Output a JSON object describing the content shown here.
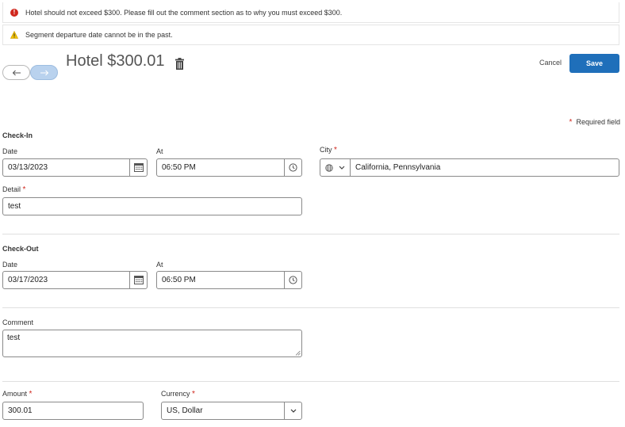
{
  "alerts": {
    "error": "Hotel should not exceed $300. Please fill out the comment section as to why you must exceed $300.",
    "warning": "Segment departure date cannot be in the past."
  },
  "header": {
    "title": "Hotel $300.01",
    "cancel_label": "Cancel",
    "save_label": "Save"
  },
  "required_note": "Required field",
  "checkin": {
    "section": "Check-In",
    "date_label": "Date",
    "date_value": "03/13/2023",
    "at_label": "At",
    "at_value": "06:50 PM",
    "city_label": "City",
    "city_value": "California, Pennsylvania",
    "detail_label": "Detail",
    "detail_value": "test"
  },
  "checkout": {
    "section": "Check-Out",
    "date_label": "Date",
    "date_value": "03/17/2023",
    "at_label": "At",
    "at_value": "06:50 PM"
  },
  "comment": {
    "label": "Comment",
    "value": "test"
  },
  "amount": {
    "label": "Amount",
    "value": "300.01"
  },
  "currency": {
    "label": "Currency",
    "value": "US, Dollar"
  },
  "colors": {
    "primary": "#1f6fba",
    "error": "#d0271d",
    "warning": "#f2c200"
  }
}
